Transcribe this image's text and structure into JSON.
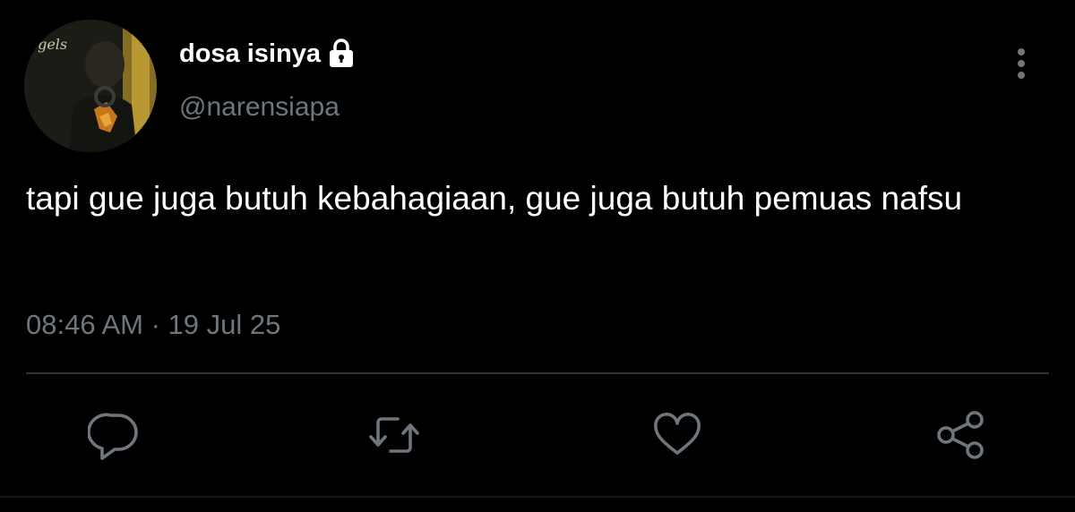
{
  "tweet": {
    "author": {
      "display_name": "dosa isinya",
      "handle": "@narensiapa",
      "protected_icon": "lock-icon",
      "avatar_text": "·gels"
    },
    "text": "tapi gue juga butuh kebahagiaan, gue juga butuh pemuas nafsu",
    "time": "08:46 AM",
    "separator": " · ",
    "date": "19 Jul 25"
  },
  "actions": [
    {
      "name": "reply",
      "icon": "reply-icon"
    },
    {
      "name": "retweet",
      "icon": "retweet-icon"
    },
    {
      "name": "like",
      "icon": "heart-icon"
    },
    {
      "name": "share",
      "icon": "share-icon"
    }
  ],
  "menu": {
    "icon": "more-vertical-icon"
  },
  "colors": {
    "background": "#000000",
    "primary_text": "#ffffff",
    "secondary_text": "#6e767d",
    "divider": "#2f3336"
  }
}
